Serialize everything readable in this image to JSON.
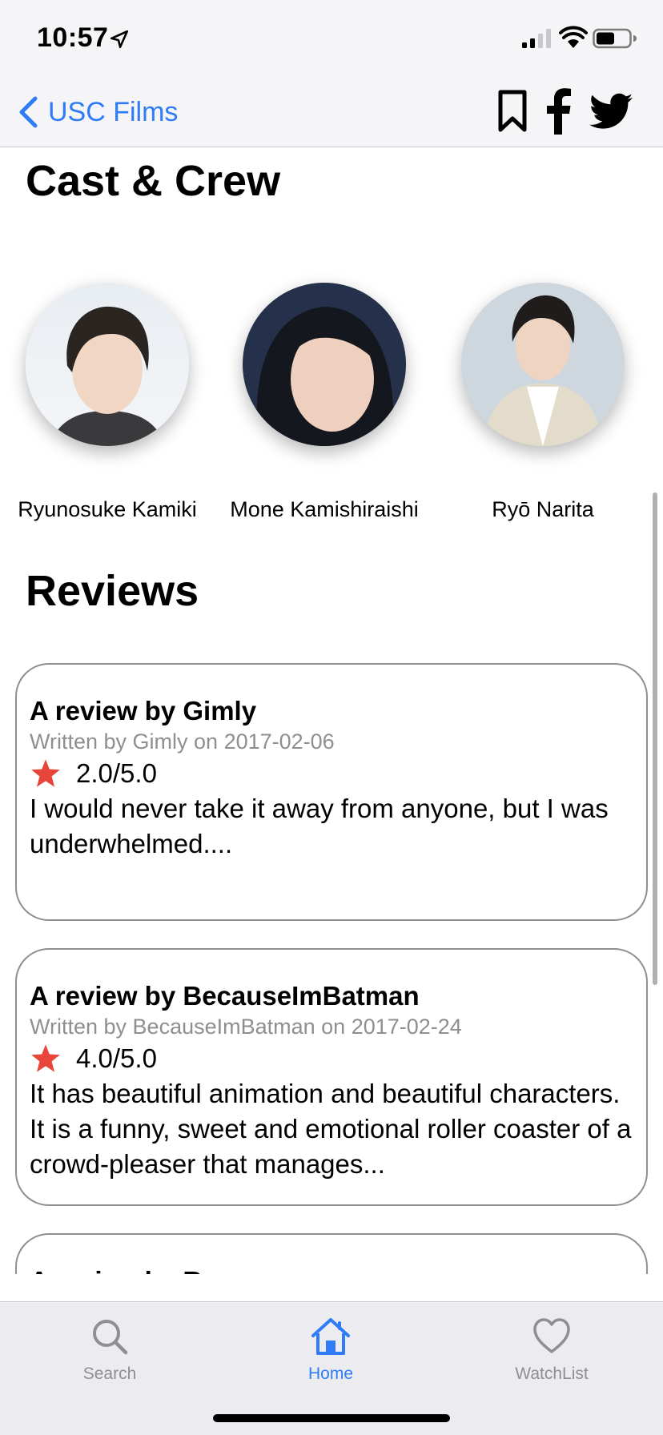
{
  "status_bar": {
    "time": "10:57",
    "icons": [
      "location-arrow-icon",
      "signal-icon",
      "wifi-icon",
      "battery-icon"
    ]
  },
  "nav": {
    "back_label": "USC Films",
    "actions": [
      "bookmark-icon",
      "facebook-icon",
      "twitter-icon"
    ],
    "accent_color": "#2f7cf6"
  },
  "cast_section": {
    "title": "Cast & Crew",
    "members": [
      {
        "name": "Ryunosuke Kamiki"
      },
      {
        "name": "Mone Kamishiraishi"
      },
      {
        "name": "Ryō Narita"
      }
    ]
  },
  "reviews_section": {
    "title": "Reviews",
    "star_color": "#e8463a",
    "reviews": [
      {
        "title": "A review by Gimly",
        "meta": "Written by Gimly on 2017-02-06",
        "rating": "2.0/5.0",
        "body": "I would never take it away from anyone, but I was underwhelmed...."
      },
      {
        "title": "A review by BecauseImBatman",
        "meta": "Written by BecauseImBatman on 2017-02-24",
        "rating": "4.0/5.0",
        "body": "It has beautiful animation and beautiful characters. It is a funny, sweet and emotional roller coaster of a crowd-pleaser that manages..."
      },
      {
        "title": "A review by Reno"
      }
    ]
  },
  "tab_bar": {
    "tabs": [
      {
        "label": "Search",
        "icon": "search-icon"
      },
      {
        "label": "Home",
        "icon": "home-icon",
        "active": true
      },
      {
        "label": "WatchList",
        "icon": "heart-icon"
      }
    ]
  }
}
